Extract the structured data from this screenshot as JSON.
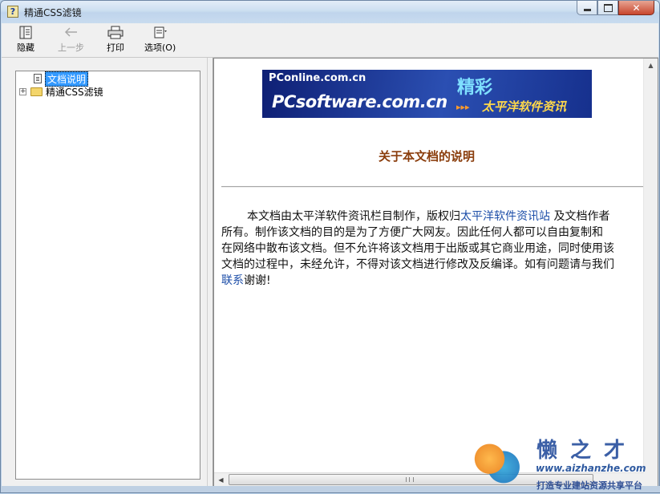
{
  "window": {
    "title": "精通CSS滤镜",
    "minimize_glyph": "",
    "close_glyph": "✕"
  },
  "toolbar": {
    "hide_label": "隐藏",
    "back_label": "上一步",
    "print_label": "打印",
    "options_label": "选项(O)"
  },
  "nav": {
    "items": [
      {
        "label": "文档说明",
        "icon": "document-icon",
        "selected": true
      },
      {
        "label": "精通CSS滤镜",
        "icon": "folder-icon",
        "expander": "+"
      }
    ]
  },
  "content": {
    "banner": {
      "line1": "PConline.com.cn",
      "line2": "PCsoftware.com.cn",
      "highlight": "精彩",
      "arrows": "▸▸▸",
      "tagline": "太平洋软件资讯"
    },
    "doc_title": "关于本文档的说明",
    "para": {
      "l1_a": "本文档由太平洋软件资讯栏目制作，版权归",
      "l1_link": "太平洋软件资讯站",
      "l1_b": " 及文档作者",
      "l2": "所有。制作该文档的目的是为了方便广大网友。因此任何人都可以自由复制和",
      "l3": "在网络中散布该文档。但不允许将该文档用于出版或其它商业用途，同时使用该",
      "l4": "文档的过程中，未经允许，不得对该文档进行修改及反编译。如有问题请与我们",
      "l5_link": "联系",
      "l5_b": "谢谢!"
    }
  },
  "watermark": {
    "t1": "懒之才",
    "t2": "www.aizhanzhe.com",
    "t3": "打造专业建站资源共享平台"
  }
}
